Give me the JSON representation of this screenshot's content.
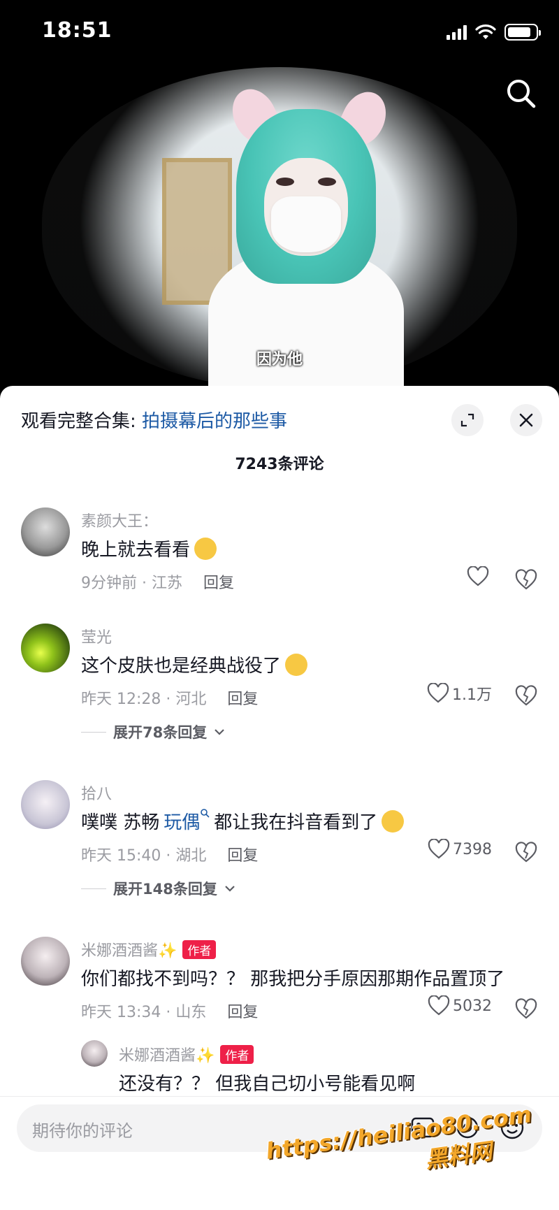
{
  "status_bar": {
    "time": "18:51",
    "battery_level": 0.85
  },
  "video": {
    "subtitle": "因为他",
    "search_icon": "search-icon"
  },
  "sheet": {
    "collection_prefix": "观看完整合集: ",
    "collection_title": "拍摄幕后的那些事",
    "comment_count": "7243条评论"
  },
  "comments": [
    {
      "username": "素颜大王：",
      "text": "晚上就去看看",
      "time": "9分钟前 · 江苏",
      "reply": "回复",
      "likes": ""
    },
    {
      "username": "莹光",
      "text": "这个皮肤也是经典战役了",
      "time": "昨天 12:28 · 河北",
      "reply": "回复",
      "likes": "1.1万",
      "expand": "展开78条回复"
    },
    {
      "username": "拾八",
      "text_prefix": "噗噗 苏畅 ",
      "mention": "玩偶",
      "text_suffix": " 都让我在抖音看到了",
      "time": "昨天 15:40 · 湖北",
      "reply": "回复",
      "likes": "7398",
      "expand": "展开148条回复"
    },
    {
      "username": "米娜酒酒酱✨",
      "author_tag": "作者",
      "text": "你们都找不到吗？？ 那我把分手原因那期作品置顶了",
      "time": "昨天 13:34 · 山东",
      "reply": "回复",
      "likes": "5032"
    }
  ],
  "sub_reply": {
    "username": "米娜酒酒酱✨",
    "author_tag": "作者",
    "text": "还没有？？ 但我自己切小号能看见啊"
  },
  "input": {
    "placeholder": "期待你的评论"
  },
  "watermark": {
    "url": "https://heiliao80.com",
    "name": "黑料网"
  }
}
